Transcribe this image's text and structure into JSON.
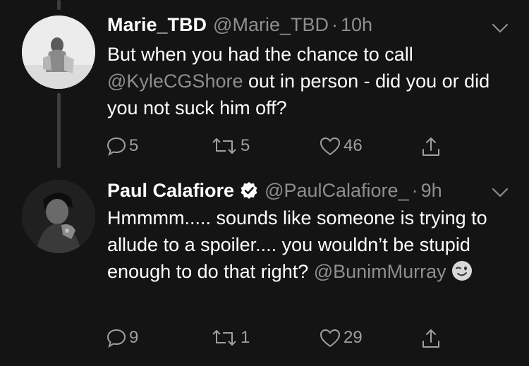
{
  "colors": {
    "background": "#141414",
    "muted": "#8e8e8e",
    "text": "#ffffff"
  },
  "tweets": [
    {
      "name": "Marie_TBD",
      "handle": "@Marie_TBD",
      "separator": "·",
      "time": "10h",
      "verified": false,
      "text_parts": [
        "But when you had the chance to call ",
        "@KyleCGShore",
        " out in person - did you or did you not suck him off?"
      ],
      "replies": "5",
      "retweets": "5",
      "likes": "46",
      "icons": [
        "reply-icon",
        "retweet-icon",
        "heart-icon",
        "share-icon",
        "chevron-down-icon"
      ]
    },
    {
      "name": "Paul Calafiore",
      "handle": "@PaulCalafiore_",
      "separator": "·",
      "time": "9h",
      "verified": true,
      "text_parts": [
        "Hmmmm..... sounds like someone is trying to allude to a spoiler.... you wouldn’t be stupid enough to do that right? ",
        "@BunimMurray"
      ],
      "emoji": "winking-face-emoji",
      "replies": "9",
      "retweets": "1",
      "likes": "29",
      "icons": [
        "reply-icon",
        "retweet-icon",
        "heart-icon",
        "share-icon",
        "chevron-down-icon",
        "verified-badge-icon"
      ]
    }
  ]
}
